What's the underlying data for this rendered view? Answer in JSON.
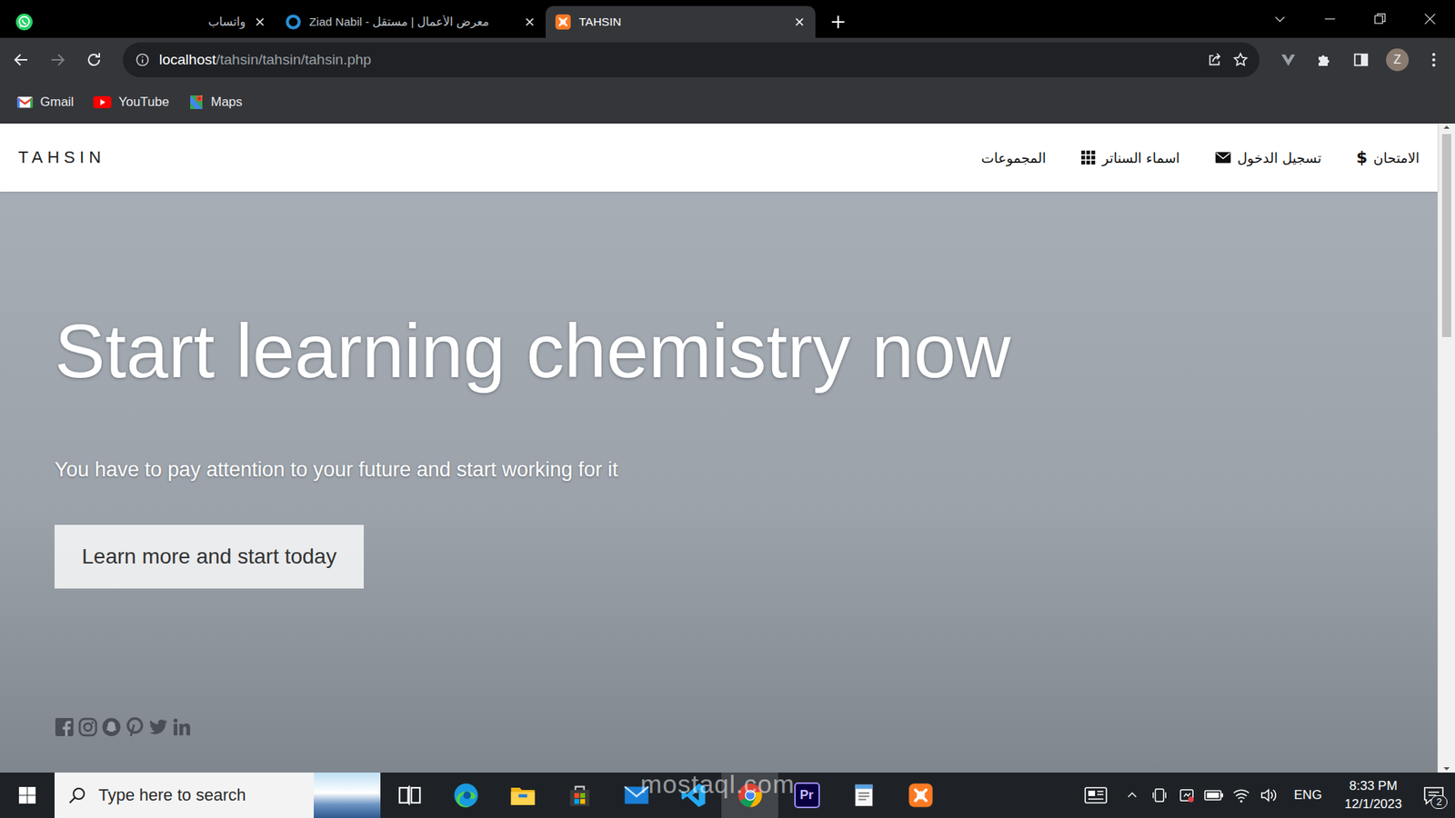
{
  "browser": {
    "tabs": [
      {
        "label": "واتساب",
        "selected": false,
        "kind": "whatsapp"
      },
      {
        "label": "Ziad Nabil - معرض الأعمال | مستقل",
        "selected": false,
        "kind": "mostaql"
      },
      {
        "label": "TAHSIN",
        "selected": true,
        "kind": "xampp"
      }
    ],
    "address": {
      "host": "localhost",
      "path": "/tahsin/tahsin/tahsin.php"
    },
    "profile": "Z",
    "bookmarks": [
      {
        "label": "Gmail",
        "kind": "gmail"
      },
      {
        "label": "YouTube",
        "kind": "youtube"
      },
      {
        "label": "Maps",
        "kind": "maps"
      }
    ]
  },
  "page": {
    "logo": "TAHSIN",
    "nav": [
      {
        "label": "الامتحان",
        "kind": "dollar",
        "glyph": "$"
      },
      {
        "label": "تسجيل الدخول",
        "kind": "mail"
      },
      {
        "label": "اسماء السناتر",
        "kind": "grid"
      },
      {
        "label": "المجموعات",
        "kind": "none"
      }
    ],
    "hero": {
      "title": "Start learning chemistry now",
      "subtitle": "You have to pay attention to your future and start working for it",
      "button": "Learn more and start today"
    }
  },
  "taskbar": {
    "search": {
      "placeholder": "Type here to search"
    },
    "pinned": [
      {
        "kind": "taskview",
        "selected": false
      },
      {
        "kind": "edge",
        "selected": false
      },
      {
        "kind": "explorer",
        "selected": false
      },
      {
        "kind": "store",
        "selected": false
      },
      {
        "kind": "mail",
        "selected": false
      },
      {
        "kind": "vscode",
        "selected": false
      },
      {
        "kind": "chrome",
        "selected": true
      },
      {
        "kind": "premiere",
        "selected": false,
        "label": "Pr"
      },
      {
        "kind": "notepad",
        "selected": false
      },
      {
        "kind": "xampp",
        "selected": false
      }
    ],
    "language": "ENG",
    "time": "8:33 PM",
    "date": "12/1/2023",
    "notifications": "2"
  },
  "watermark": "mostaql.com"
}
